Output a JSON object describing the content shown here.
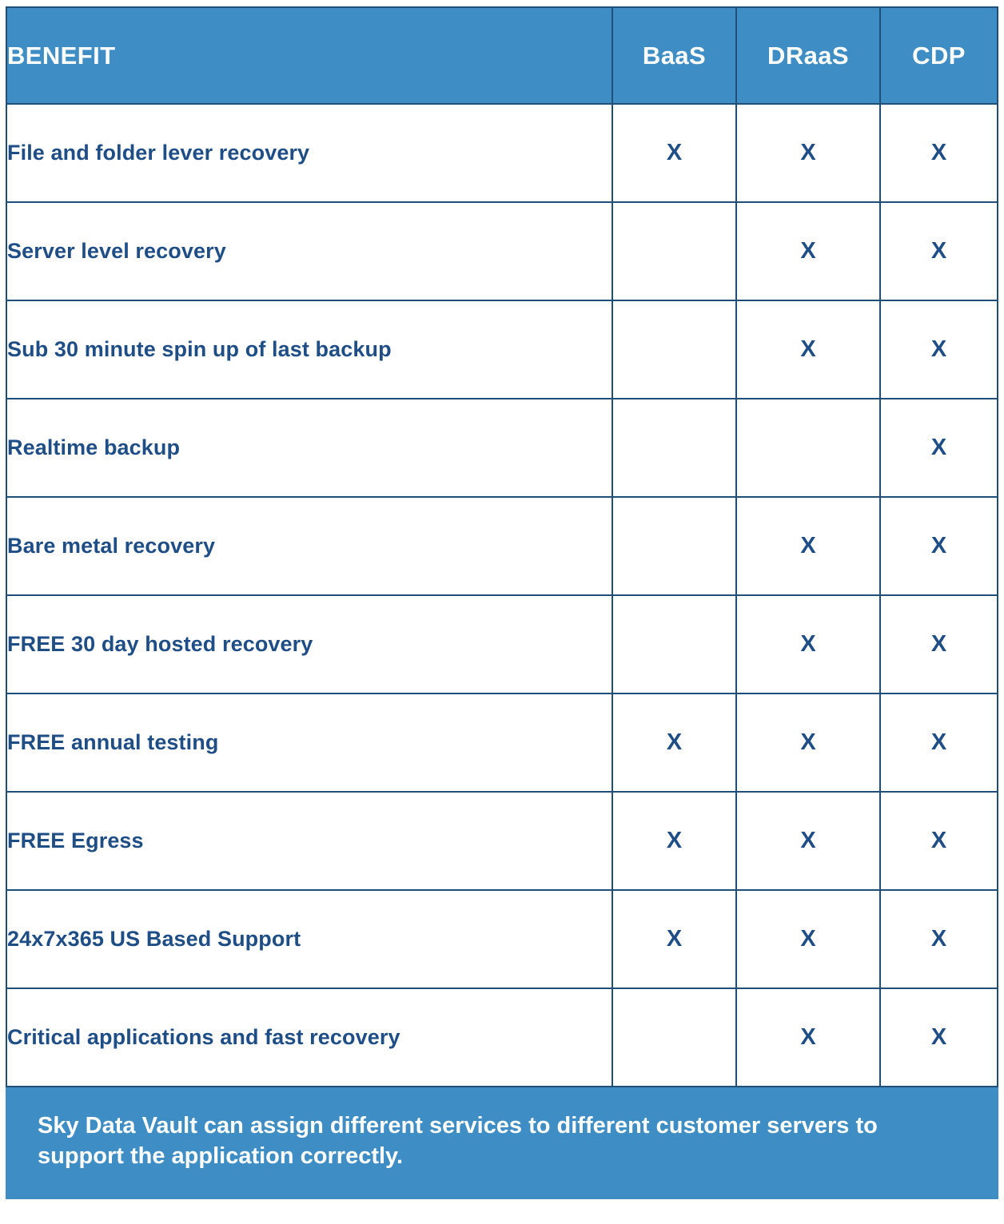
{
  "table": {
    "columns": [
      {
        "key": "benefit",
        "label": "BENEFIT"
      },
      {
        "key": "baas",
        "label": "BaaS"
      },
      {
        "key": "draas",
        "label": "DRaaS"
      },
      {
        "key": "cdp",
        "label": "CDP"
      }
    ],
    "mark": "X",
    "rows": [
      {
        "benefit": "File and folder lever recovery",
        "baas": "X",
        "draas": "X",
        "cdp": "X"
      },
      {
        "benefit": "Server level recovery",
        "baas": "",
        "draas": "X",
        "cdp": "X"
      },
      {
        "benefit": "Sub 30 minute spin up of last backup",
        "baas": "",
        "draas": "X",
        "cdp": "X"
      },
      {
        "benefit": "Realtime backup",
        "baas": "",
        "draas": "",
        "cdp": "X"
      },
      {
        "benefit": "Bare metal recovery",
        "baas": "",
        "draas": "X",
        "cdp": "X"
      },
      {
        "benefit": "FREE 30 day hosted recovery",
        "baas": "",
        "draas": "X",
        "cdp": "X"
      },
      {
        "benefit": "FREE annual testing",
        "baas": "X",
        "draas": "X",
        "cdp": "X"
      },
      {
        "benefit": "FREE Egress",
        "baas": "X",
        "draas": "X",
        "cdp": "X"
      },
      {
        "benefit": "24x7x365 US Based Support",
        "baas": "X",
        "draas": "X",
        "cdp": "X"
      },
      {
        "benefit": "Critical applications and fast recovery",
        "baas": "",
        "draas": "X",
        "cdp": "X"
      }
    ],
    "footer_note": "Sky Data Vault can assign different services to different customer servers to support the application correctly."
  },
  "colors": {
    "header_background": "#3e8dc4",
    "header_text": "#ffffff",
    "border": "#1f4e79",
    "body_text": "#1f4e86",
    "body_background": "#ffffff",
    "footer_background": "#3e8dc4",
    "footer_text": "#ffffff"
  }
}
